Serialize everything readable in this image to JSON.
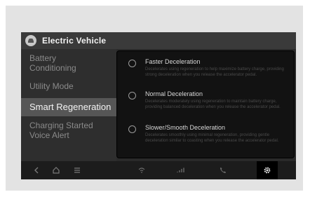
{
  "header": {
    "title": "Electric Vehicle",
    "app_icon": "car-icon"
  },
  "sidebar": {
    "items": [
      {
        "label_line1": "Battery",
        "label_line2": "Conditioning"
      },
      {
        "label_line1": "Utility Mode"
      },
      {
        "label_line1": "Smart Regeneration",
        "selected": true
      },
      {
        "label_line1": "Charging Started",
        "label_line2": "Voice Alert"
      }
    ]
  },
  "options": [
    {
      "title": "Faster Deceleration",
      "desc": "Decelerates using regeneration to help maximize battery charge, providing strong deceleration when you release the accelerator pedal."
    },
    {
      "title": "Normal Deceleration",
      "desc": "Decelerates moderately using regeneration to maintain battery charge, providing balanced deceleration when you release the accelerator pedal."
    },
    {
      "title": "Slower/Smooth Deceleration",
      "desc": "Decelerates smoothly using minimal regeneration, providing gentle deceleration similar to coasting when you release the accelerator pedal."
    }
  ],
  "bottombar": {
    "icons": [
      "back-icon",
      "home-icon",
      "menu-icon",
      "wifi-icon",
      "signal-icon",
      "phone-icon",
      "settings-gear-icon"
    ]
  },
  "colors": {
    "screen": "#2a2a2a",
    "selected": "#565656",
    "panel": "#121212"
  }
}
